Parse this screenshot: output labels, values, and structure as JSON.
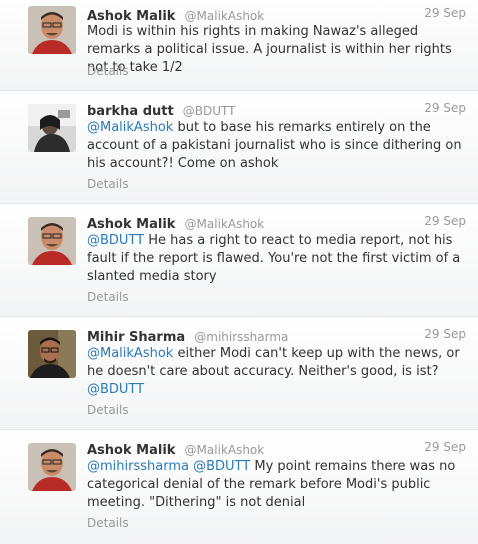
{
  "tweets": [
    {
      "name": "Ashok Malik",
      "handle": "@MalikAshok",
      "time": "29 Sep",
      "text_1": "Modi is within his rights in making Nawaz's alleged remarks a political issue. A journalist is within her rights not to take 1/2",
      "details": "Details",
      "avatar": "portrait-ashok-malik"
    },
    {
      "name": "barkha dutt",
      "handle": "@BDUTT",
      "time": "29 Sep",
      "mention_1": "@MalikAshok",
      "text_1": " but to base his remarks entirely on the account of a pakistani journalist who is since dithering on his account?! Come on ashok",
      "details": "Details",
      "avatar": "portrait-barkha-dutt"
    },
    {
      "name": "Ashok Malik",
      "handle": "@MalikAshok",
      "time": "29 Sep",
      "mention_1": "@BDUTT",
      "text_1": " He has a right to react to media report, not his fault if the  report is flawed. You're not the first victim of a slanted media story",
      "details": "Details",
      "avatar": "portrait-ashok-malik"
    },
    {
      "name": "Mihir Sharma",
      "handle": "@mihirssharma",
      "time": "29 Sep",
      "mention_1": "@MalikAshok",
      "text_1": " either Modi can't keep up with the news, or he doesn't care about accuracy. Neither's good, is ist?",
      "mention_2": "@BDUTT",
      "details": "Details",
      "avatar": "portrait-mihir-sharma"
    },
    {
      "name": "Ashok Malik",
      "handle": "@MalikAshok",
      "time": "29 Sep",
      "mention_1": "@mihirssharma",
      "text_1": " ",
      "mention_2": "@BDUTT",
      "text_2": " My point remains there was no categorical denial of the remark before Modi's public meeting. \"Dithering\" is not denial",
      "details": "Details",
      "avatar": "portrait-ashok-malik"
    }
  ],
  "colors": {
    "link": "#2b7bb9",
    "meta": "#999999",
    "text": "#333333"
  }
}
